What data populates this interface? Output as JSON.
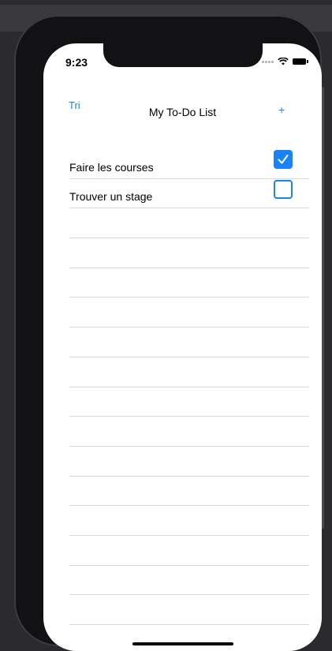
{
  "status": {
    "time": "9:23"
  },
  "nav": {
    "left_label": "Tri",
    "title": "My To-Do List",
    "right_label": "+"
  },
  "todos": [
    {
      "label": "Faire les courses",
      "checked": true
    },
    {
      "label": "Trouver un stage",
      "checked": false
    }
  ],
  "icons": {
    "checked": "checkmark-icon",
    "wifi": "wifi-icon",
    "battery": "battery-icon",
    "cellular": "cellular-signal-icon"
  },
  "colors": {
    "accent": "#1a82f7",
    "separator": "#d9d9d9",
    "text": "#000000",
    "device": "#121214"
  }
}
